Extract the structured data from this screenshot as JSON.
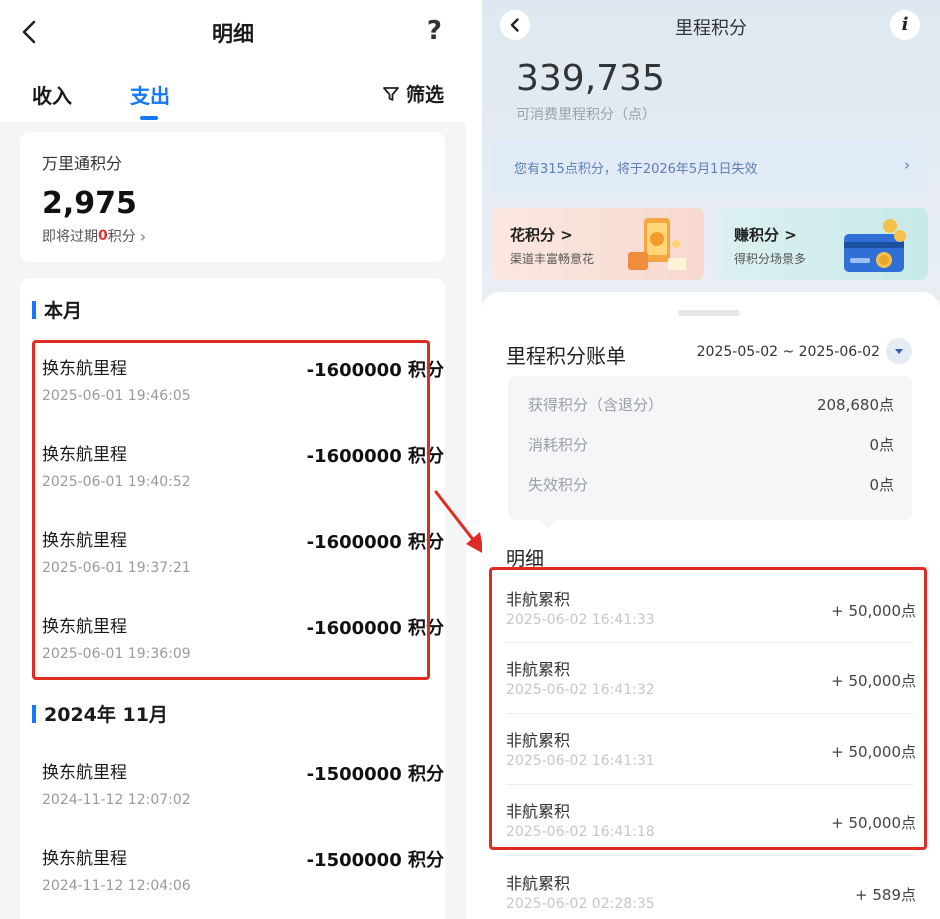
{
  "left": {
    "nav": {
      "title": "明细",
      "help": "?"
    },
    "tabs": [
      {
        "label": "收入"
      },
      {
        "label": "支出"
      }
    ],
    "filter_label": "筛选",
    "points_card": {
      "label": "万里通积分",
      "value": "2,975",
      "expiring_prefix": "即将过期",
      "expiring_count": "0",
      "expiring_suffix": "积分"
    },
    "sections": [
      {
        "title": "本月",
        "items": [
          {
            "name": "换东航里程",
            "amount": "-1600000 积分",
            "time": "2025-06-01 19:46:05"
          },
          {
            "name": "换东航里程",
            "amount": "-1600000 积分",
            "time": "2025-06-01 19:40:52"
          },
          {
            "name": "换东航里程",
            "amount": "-1600000 积分",
            "time": "2025-06-01 19:37:21"
          },
          {
            "name": "换东航里程",
            "amount": "-1600000 积分",
            "time": "2025-06-01 19:36:09"
          }
        ]
      },
      {
        "title": "2024年 11月",
        "items": [
          {
            "name": "换东航里程",
            "amount": "-1500000 积分",
            "time": "2024-11-12 12:07:02"
          },
          {
            "name": "换东航里程",
            "amount": "-1500000 积分",
            "time": "2024-11-12 12:04:06"
          }
        ]
      }
    ]
  },
  "right": {
    "nav": {
      "title": "里程积分",
      "info": "i"
    },
    "balance": "339,735",
    "balance_label": "可消费里程积分（点）",
    "notice": "您有315点积分，将于2026年5月1日失效",
    "promos": [
      {
        "title": "花积分 >",
        "subtitle": "渠道丰富畅意花"
      },
      {
        "title": "赚积分 >",
        "subtitle": "得积分场景多"
      }
    ],
    "bill": {
      "title": "里程积分账单",
      "range": "2025-05-02 ~ 2025-06-02",
      "summary": [
        {
          "label": "获得积分（含退分）",
          "value": "208,680点"
        },
        {
          "label": "消耗积分",
          "value": "0点"
        },
        {
          "label": "失效积分",
          "value": "0点"
        }
      ]
    },
    "detail_title": "明细",
    "details": [
      {
        "name": "非航累积",
        "time": "2025-06-02 16:41:33",
        "amount": "+ 50,000点"
      },
      {
        "name": "非航累积",
        "time": "2025-06-02 16:41:32",
        "amount": "+ 50,000点"
      },
      {
        "name": "非航累积",
        "time": "2025-06-02 16:41:31",
        "amount": "+ 50,000点"
      },
      {
        "name": "非航累积",
        "time": "2025-06-02 16:41:18",
        "amount": "+ 50,000点"
      },
      {
        "name": "非航累积",
        "time": "2025-06-02 02:28:35",
        "amount": "+ 589点"
      }
    ]
  },
  "colors": {
    "accent": "#1677ff",
    "highlight": "#e02b22",
    "expiring": "#e23636"
  }
}
